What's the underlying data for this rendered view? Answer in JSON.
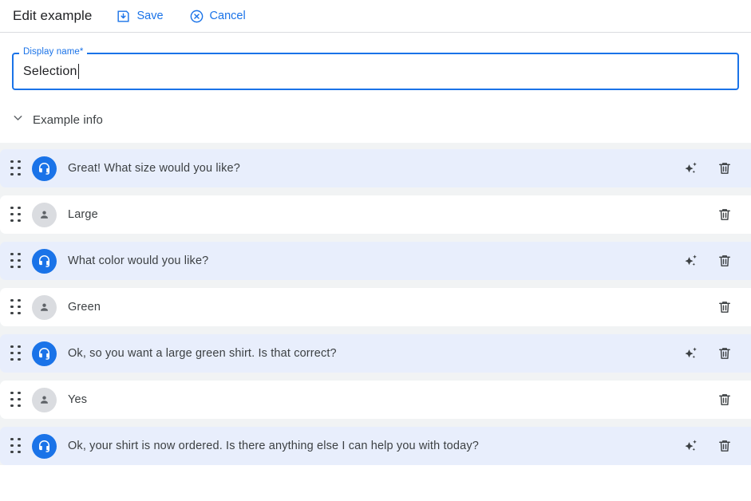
{
  "header": {
    "title": "Edit example",
    "save_label": "Save",
    "save_icon": "save-icon",
    "cancel_label": "Cancel",
    "cancel_icon": "cancel-circle-icon"
  },
  "display_name_field": {
    "label": "Display name*",
    "value": "Selection",
    "placeholder": ""
  },
  "example_info": {
    "label": "Example info",
    "chevron_icon": "chevron-down-icon",
    "expanded": true
  },
  "colors": {
    "accent": "#1a73e8",
    "agent_row_bg": "#e8eefc",
    "user_row_bg": "#ffffff",
    "list_bg": "#f1f3f4",
    "text": "#3c4043"
  },
  "conversation": {
    "turns": [
      {
        "speaker": "agent",
        "avatar_icon": "headset-icon",
        "text": "Great! What size would you like?",
        "has_sparkle": true,
        "sparkle_icon": "sparkle-icon",
        "delete_icon": "trash-icon"
      },
      {
        "speaker": "user",
        "avatar_icon": "person-icon",
        "text": "Large",
        "has_sparkle": false,
        "sparkle_icon": "",
        "delete_icon": "trash-icon"
      },
      {
        "speaker": "agent",
        "avatar_icon": "headset-icon",
        "text": "What color would you like?",
        "has_sparkle": true,
        "sparkle_icon": "sparkle-icon",
        "delete_icon": "trash-icon"
      },
      {
        "speaker": "user",
        "avatar_icon": "person-icon",
        "text": "Green",
        "has_sparkle": false,
        "sparkle_icon": "",
        "delete_icon": "trash-icon"
      },
      {
        "speaker": "agent",
        "avatar_icon": "headset-icon",
        "text": "Ok, so you want a large green shirt. Is that correct?",
        "has_sparkle": true,
        "sparkle_icon": "sparkle-icon",
        "delete_icon": "trash-icon"
      },
      {
        "speaker": "user",
        "avatar_icon": "person-icon",
        "text": "Yes",
        "has_sparkle": false,
        "sparkle_icon": "",
        "delete_icon": "trash-icon"
      },
      {
        "speaker": "agent",
        "avatar_icon": "headset-icon",
        "text": "Ok, your shirt is now ordered. Is there anything else I can help you with today?",
        "has_sparkle": true,
        "sparkle_icon": "sparkle-icon",
        "delete_icon": "trash-icon"
      }
    ]
  }
}
